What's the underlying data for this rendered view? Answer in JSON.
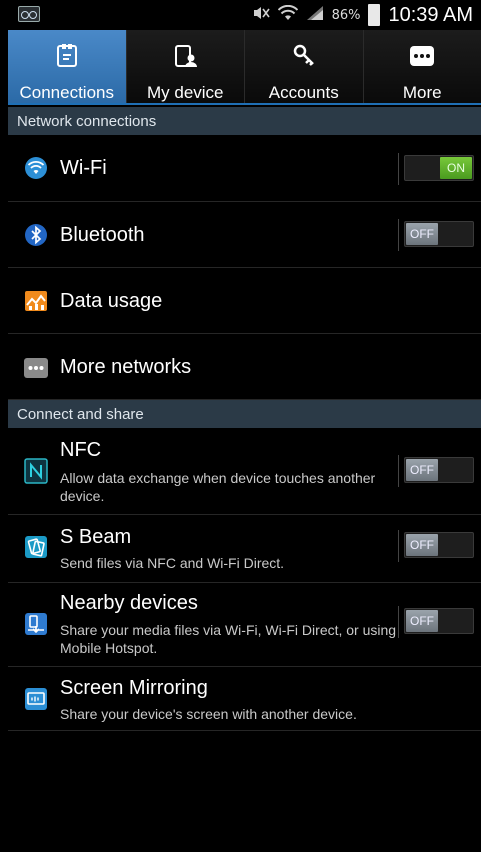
{
  "status_bar": {
    "battery_percent": "86%",
    "time": "10:39 AM",
    "icons": [
      "voicemail-icon",
      "mute-icon",
      "wifi-icon",
      "signal-icon",
      "battery-icon"
    ]
  },
  "tabs": [
    {
      "label": "Connections",
      "icon": "connections-icon",
      "active": true
    },
    {
      "label": "My device",
      "icon": "my-device-icon",
      "active": false
    },
    {
      "label": "Accounts",
      "icon": "accounts-icon",
      "active": false
    },
    {
      "label": "More",
      "icon": "more-icon",
      "active": false
    }
  ],
  "sections": {
    "network": "Network connections",
    "share": "Connect and share"
  },
  "network_items": {
    "wifi": {
      "title": "Wi-Fi",
      "toggle": "ON"
    },
    "bluetooth": {
      "title": "Bluetooth",
      "toggle": "OFF"
    },
    "data_usage": {
      "title": "Data usage"
    },
    "more_networks": {
      "title": "More networks"
    }
  },
  "share_items": {
    "nfc": {
      "title": "NFC",
      "subtitle": "Allow data exchange when device touches another device.",
      "toggle": "OFF"
    },
    "sbeam": {
      "title": "S Beam",
      "subtitle": "Send files via NFC and Wi-Fi Direct.",
      "toggle": "OFF"
    },
    "nearby": {
      "title": "Nearby devices",
      "subtitle": "Share your media files via Wi-Fi, Wi-Fi Direct, or using Mobile Hotspot.",
      "toggle": "OFF"
    },
    "mirroring": {
      "title": "Screen Mirroring",
      "subtitle": "Share your device's screen with another device."
    }
  },
  "colors": {
    "accent": "#2b6aa7",
    "section_bg": "#2b3a47",
    "toggle_on": "#5bb02a"
  }
}
